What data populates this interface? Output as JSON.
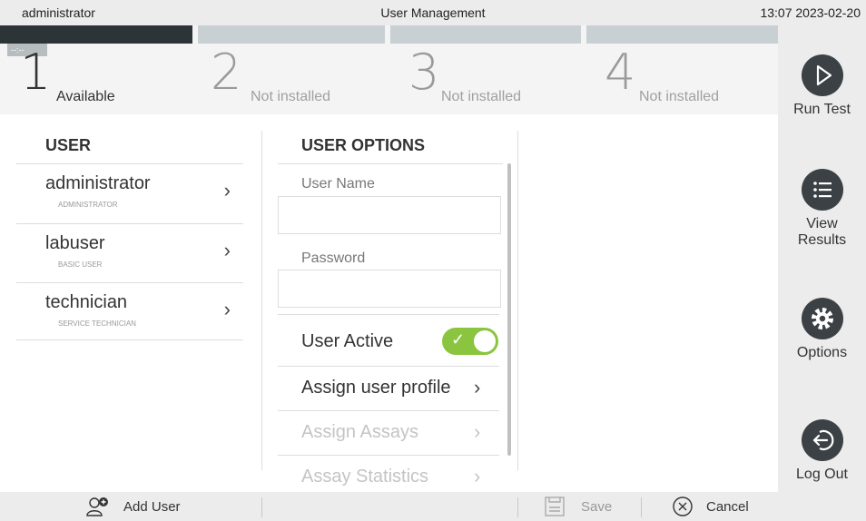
{
  "topbar": {
    "user": "administrator",
    "title": "User Management",
    "clock": "13:07 2023-02-20"
  },
  "slots": [
    {
      "number": "1",
      "label": "Available",
      "time": "--:--"
    },
    {
      "number": "2",
      "label": "Not installed"
    },
    {
      "number": "3",
      "label": "Not installed"
    },
    {
      "number": "4",
      "label": "Not installed"
    }
  ],
  "sidebar": {
    "run_test": "Run Test",
    "view_results": "View Results",
    "options": "Options",
    "log_out": "Log Out"
  },
  "user_panel": {
    "header": "USER",
    "users": [
      {
        "name": "administrator",
        "role": "ADMINISTRATOR"
      },
      {
        "name": "labuser",
        "role": "BASIC USER"
      },
      {
        "name": "technician",
        "role": "SERVICE TECHNICIAN"
      }
    ]
  },
  "options_panel": {
    "header": "USER OPTIONS",
    "user_name_label": "User Name",
    "password_label": "Password",
    "user_active_label": "User Active",
    "user_active": true,
    "assign_profile": "Assign user profile",
    "assign_assays": "Assign Assays",
    "assay_statistics": "Assay Statistics"
  },
  "bottom": {
    "add_user": "Add User",
    "save": "Save",
    "cancel": "Cancel"
  },
  "colors": {
    "toggle_on": "#8bc53f",
    "dark": "#3b4144"
  }
}
